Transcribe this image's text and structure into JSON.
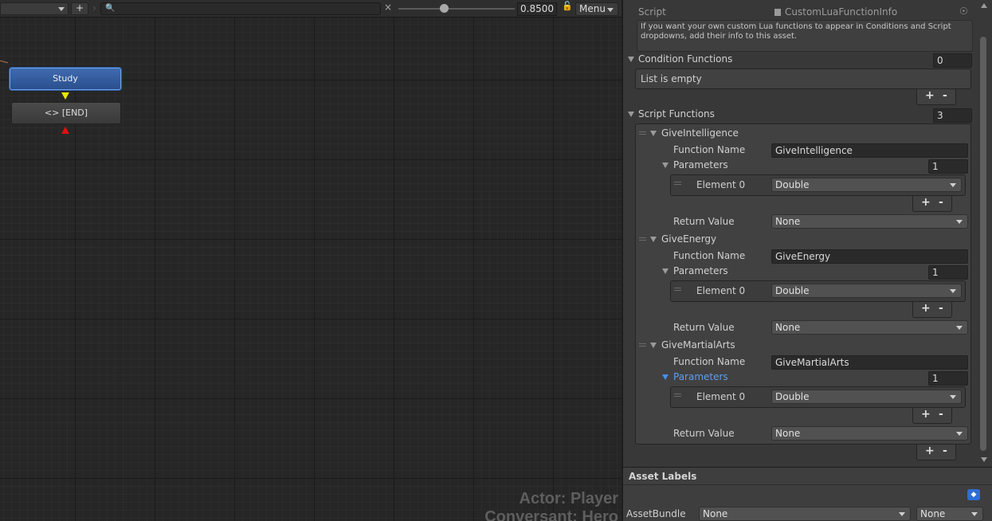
{
  "toolbar": {
    "zoom_value": "0.8500",
    "menu_label": "Menu",
    "add_label": "+",
    "clear_label": "×"
  },
  "graph": {
    "nodes": {
      "study": "Study",
      "end": "<> [END]"
    },
    "overlay": {
      "actor": "Actor: Player",
      "conversant": "Conversant: Hero"
    }
  },
  "inspector": {
    "script_label": "Script",
    "script_value": "CustomLuaFunctionInfo",
    "help_text": "If you want your own custom Lua functions to appear in Conditions and Script dropdowns, add their info to this asset.",
    "condition_functions": {
      "label": "Condition Functions",
      "count": "0",
      "empty_text": "List is empty"
    },
    "script_functions": {
      "label": "Script Functions",
      "count": "3",
      "items": [
        {
          "header": "GiveIntelligence",
          "function_name_label": "Function Name",
          "function_name": "GiveIntelligence",
          "parameters_label": "Parameters",
          "parameters_count": "1",
          "element_label": "Element 0",
          "element_value": "Double",
          "return_label": "Return Value",
          "return_value": "None"
        },
        {
          "header": "GiveEnergy",
          "function_name_label": "Function Name",
          "function_name": "GiveEnergy",
          "parameters_label": "Parameters",
          "parameters_count": "1",
          "element_label": "Element 0",
          "element_value": "Double",
          "return_label": "Return Value",
          "return_value": "None"
        },
        {
          "header": "GiveMartialArts",
          "function_name_label": "Function Name",
          "function_name": "GiveMartialArts",
          "parameters_label": "Parameters",
          "parameters_count": "1",
          "element_label": "Element 0",
          "element_value": "Double",
          "return_label": "Return Value",
          "return_value": "None"
        }
      ]
    },
    "plus_label": "+",
    "minus_label": "-",
    "asset_labels": {
      "title": "Asset Labels",
      "assetbundle_label": "AssetBundle",
      "assetbundle_value": "None",
      "variant_value": "None"
    }
  },
  "colors": {
    "selected_node": "#2f5a9e",
    "accent_blue": "#4a8ee8",
    "end_arrow": "#e01010",
    "start_arrow": "#e6e600"
  }
}
